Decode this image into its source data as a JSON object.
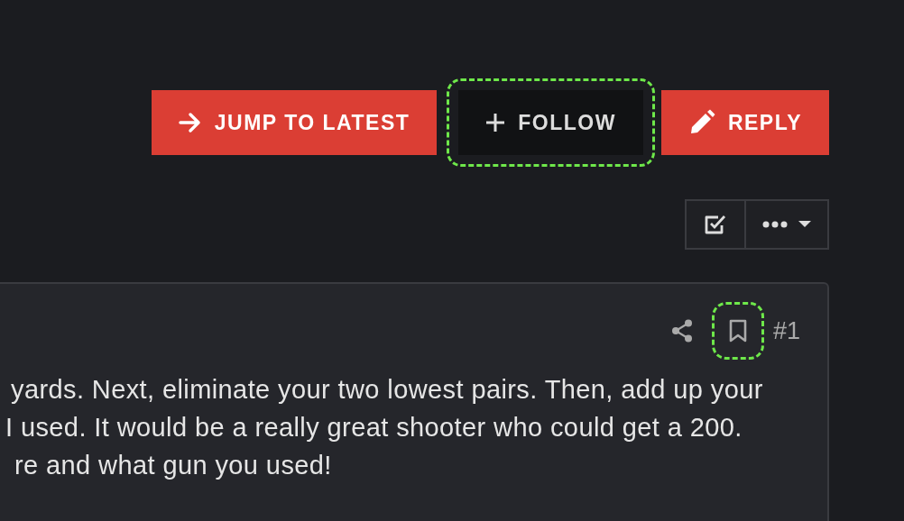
{
  "actions": [
    {
      "kind": "jump",
      "label": "JUMP TO LATEST",
      "highlighted": false
    },
    {
      "kind": "follow",
      "label": "FOLLOW",
      "highlighted": true
    },
    {
      "kind": "reply",
      "label": "REPLY",
      "highlighted": false
    }
  ],
  "tools": [
    {
      "kind": "select"
    },
    {
      "kind": "more"
    }
  ],
  "post": {
    "share_highlighted": false,
    "bookmark_highlighted": true,
    "number": "#1",
    "lines": [
      "yards. Next, eliminate your two lowest pairs. Then, add up your",
      "I used. It would be a really great shooter who could get a 200.",
      "re and what gun you used!"
    ]
  }
}
